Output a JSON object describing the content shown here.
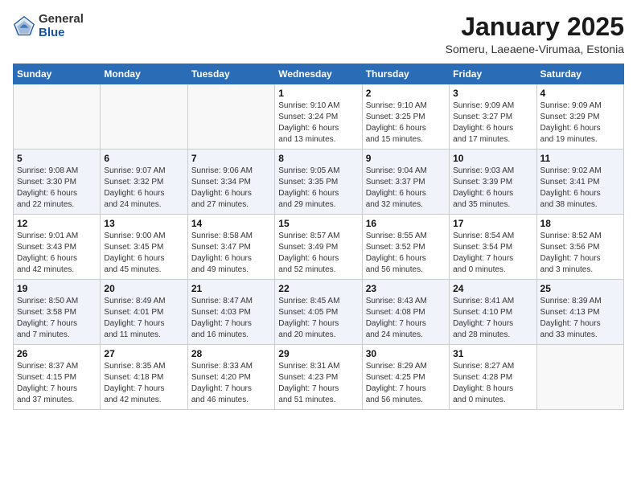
{
  "header": {
    "logo_general": "General",
    "logo_blue": "Blue",
    "title": "January 2025",
    "subtitle": "Someru, Laeaene-Virumaa, Estonia"
  },
  "days_of_week": [
    "Sunday",
    "Monday",
    "Tuesday",
    "Wednesday",
    "Thursday",
    "Friday",
    "Saturday"
  ],
  "weeks": [
    [
      {
        "day": "",
        "info": ""
      },
      {
        "day": "",
        "info": ""
      },
      {
        "day": "",
        "info": ""
      },
      {
        "day": "1",
        "info": "Sunrise: 9:10 AM\nSunset: 3:24 PM\nDaylight: 6 hours\nand 13 minutes."
      },
      {
        "day": "2",
        "info": "Sunrise: 9:10 AM\nSunset: 3:25 PM\nDaylight: 6 hours\nand 15 minutes."
      },
      {
        "day": "3",
        "info": "Sunrise: 9:09 AM\nSunset: 3:27 PM\nDaylight: 6 hours\nand 17 minutes."
      },
      {
        "day": "4",
        "info": "Sunrise: 9:09 AM\nSunset: 3:29 PM\nDaylight: 6 hours\nand 19 minutes."
      }
    ],
    [
      {
        "day": "5",
        "info": "Sunrise: 9:08 AM\nSunset: 3:30 PM\nDaylight: 6 hours\nand 22 minutes."
      },
      {
        "day": "6",
        "info": "Sunrise: 9:07 AM\nSunset: 3:32 PM\nDaylight: 6 hours\nand 24 minutes."
      },
      {
        "day": "7",
        "info": "Sunrise: 9:06 AM\nSunset: 3:34 PM\nDaylight: 6 hours\nand 27 minutes."
      },
      {
        "day": "8",
        "info": "Sunrise: 9:05 AM\nSunset: 3:35 PM\nDaylight: 6 hours\nand 29 minutes."
      },
      {
        "day": "9",
        "info": "Sunrise: 9:04 AM\nSunset: 3:37 PM\nDaylight: 6 hours\nand 32 minutes."
      },
      {
        "day": "10",
        "info": "Sunrise: 9:03 AM\nSunset: 3:39 PM\nDaylight: 6 hours\nand 35 minutes."
      },
      {
        "day": "11",
        "info": "Sunrise: 9:02 AM\nSunset: 3:41 PM\nDaylight: 6 hours\nand 38 minutes."
      }
    ],
    [
      {
        "day": "12",
        "info": "Sunrise: 9:01 AM\nSunset: 3:43 PM\nDaylight: 6 hours\nand 42 minutes."
      },
      {
        "day": "13",
        "info": "Sunrise: 9:00 AM\nSunset: 3:45 PM\nDaylight: 6 hours\nand 45 minutes."
      },
      {
        "day": "14",
        "info": "Sunrise: 8:58 AM\nSunset: 3:47 PM\nDaylight: 6 hours\nand 49 minutes."
      },
      {
        "day": "15",
        "info": "Sunrise: 8:57 AM\nSunset: 3:49 PM\nDaylight: 6 hours\nand 52 minutes."
      },
      {
        "day": "16",
        "info": "Sunrise: 8:55 AM\nSunset: 3:52 PM\nDaylight: 6 hours\nand 56 minutes."
      },
      {
        "day": "17",
        "info": "Sunrise: 8:54 AM\nSunset: 3:54 PM\nDaylight: 7 hours\nand 0 minutes."
      },
      {
        "day": "18",
        "info": "Sunrise: 8:52 AM\nSunset: 3:56 PM\nDaylight: 7 hours\nand 3 minutes."
      }
    ],
    [
      {
        "day": "19",
        "info": "Sunrise: 8:50 AM\nSunset: 3:58 PM\nDaylight: 7 hours\nand 7 minutes."
      },
      {
        "day": "20",
        "info": "Sunrise: 8:49 AM\nSunset: 4:01 PM\nDaylight: 7 hours\nand 11 minutes."
      },
      {
        "day": "21",
        "info": "Sunrise: 8:47 AM\nSunset: 4:03 PM\nDaylight: 7 hours\nand 16 minutes."
      },
      {
        "day": "22",
        "info": "Sunrise: 8:45 AM\nSunset: 4:05 PM\nDaylight: 7 hours\nand 20 minutes."
      },
      {
        "day": "23",
        "info": "Sunrise: 8:43 AM\nSunset: 4:08 PM\nDaylight: 7 hours\nand 24 minutes."
      },
      {
        "day": "24",
        "info": "Sunrise: 8:41 AM\nSunset: 4:10 PM\nDaylight: 7 hours\nand 28 minutes."
      },
      {
        "day": "25",
        "info": "Sunrise: 8:39 AM\nSunset: 4:13 PM\nDaylight: 7 hours\nand 33 minutes."
      }
    ],
    [
      {
        "day": "26",
        "info": "Sunrise: 8:37 AM\nSunset: 4:15 PM\nDaylight: 7 hours\nand 37 minutes."
      },
      {
        "day": "27",
        "info": "Sunrise: 8:35 AM\nSunset: 4:18 PM\nDaylight: 7 hours\nand 42 minutes."
      },
      {
        "day": "28",
        "info": "Sunrise: 8:33 AM\nSunset: 4:20 PM\nDaylight: 7 hours\nand 46 minutes."
      },
      {
        "day": "29",
        "info": "Sunrise: 8:31 AM\nSunset: 4:23 PM\nDaylight: 7 hours\nand 51 minutes."
      },
      {
        "day": "30",
        "info": "Sunrise: 8:29 AM\nSunset: 4:25 PM\nDaylight: 7 hours\nand 56 minutes."
      },
      {
        "day": "31",
        "info": "Sunrise: 8:27 AM\nSunset: 4:28 PM\nDaylight: 8 hours\nand 0 minutes."
      },
      {
        "day": "",
        "info": ""
      }
    ]
  ]
}
